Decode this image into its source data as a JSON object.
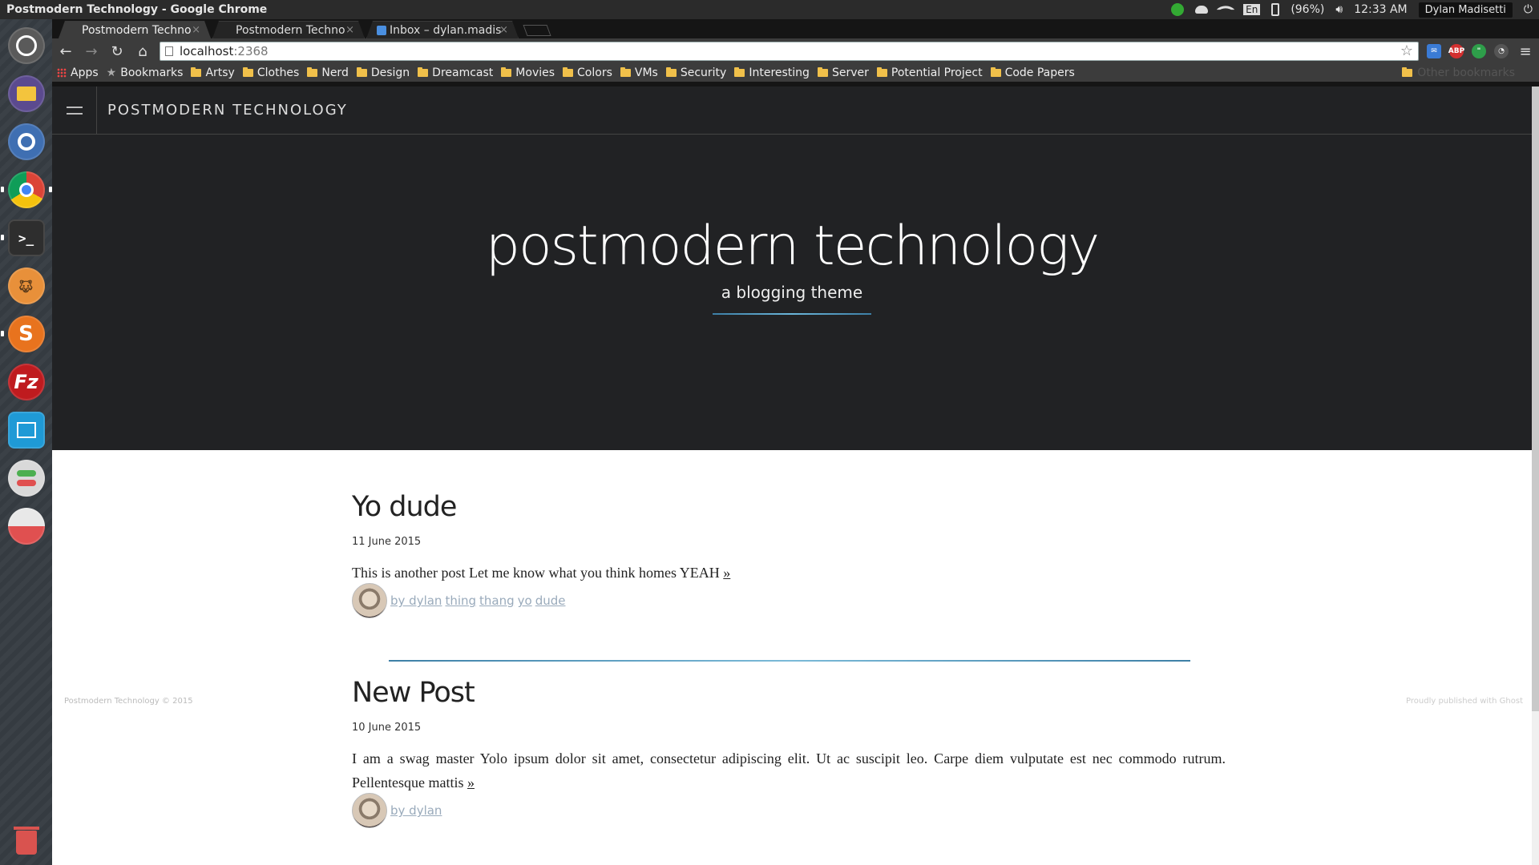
{
  "window": {
    "title": "Postmodern Technology - Google Chrome"
  },
  "tray": {
    "battery": "(96%)",
    "time": "12:33 AM",
    "user": "Dylan Madisetti",
    "keyboard": "En"
  },
  "launcher": {
    "items": [
      {
        "name": "ubuntu-dash",
        "color": "#555"
      },
      {
        "name": "files",
        "color": "#6a4ca0"
      },
      {
        "name": "chromium",
        "color": "#3b6fb3"
      },
      {
        "name": "google-chrome",
        "color": "#2e8b57"
      },
      {
        "name": "terminal",
        "color": "#333"
      },
      {
        "name": "gimp",
        "color": "#e68a2e"
      },
      {
        "name": "sublime-text",
        "color": "#e0701e"
      },
      {
        "name": "filezilla",
        "color": "#c0171d"
      },
      {
        "name": "system-monitor",
        "color": "#1e8fd0"
      },
      {
        "name": "settings",
        "color": "#ccc"
      },
      {
        "name": "disk-usage",
        "color": "#eee"
      }
    ]
  },
  "tabs": [
    {
      "label": "Postmodern Techno",
      "active": true
    },
    {
      "label": "Postmodern Techno",
      "active": false
    },
    {
      "label": "Inbox – dylan.madis",
      "active": false
    }
  ],
  "toolbar": {
    "url_host": "localhost",
    "url_port": ":2368"
  },
  "bookmarks": {
    "apps": "Apps",
    "items": [
      "Bookmarks",
      "Artsy",
      "Clothes",
      "Nerd",
      "Design",
      "Dreamcast",
      "Movies",
      "Colors",
      "VMs",
      "Security",
      "Interesting",
      "Server",
      "Potential Project",
      "Code Papers"
    ],
    "other": "Other bookmarks"
  },
  "site": {
    "nav_title": "POSTMODERN TECHNOLOGY",
    "hero_title": "postmodern technology",
    "hero_tagline": "a blogging theme"
  },
  "posts": [
    {
      "title": "Yo dude",
      "date": "11 June 2015",
      "excerpt": "This is another post Let me know what you think homes YEAH",
      "more": "»",
      "byline": "by dylan",
      "tags": [
        "thing",
        "thang",
        "yo",
        "dude"
      ]
    },
    {
      "title": "New Post",
      "date": "10 June 2015",
      "excerpt": "I am a swag master Yolo ipsum dolor sit amet, consectetur adipiscing elit. Ut ac suscipit leo. Carpe diem vulputate est nec commodo rutrum. Pellentesque mattis",
      "more": "»",
      "byline": "by dylan",
      "tags": []
    }
  ],
  "footer": {
    "left": "Postmodern Technology © 2015",
    "right": "Proudly published with Ghost"
  }
}
